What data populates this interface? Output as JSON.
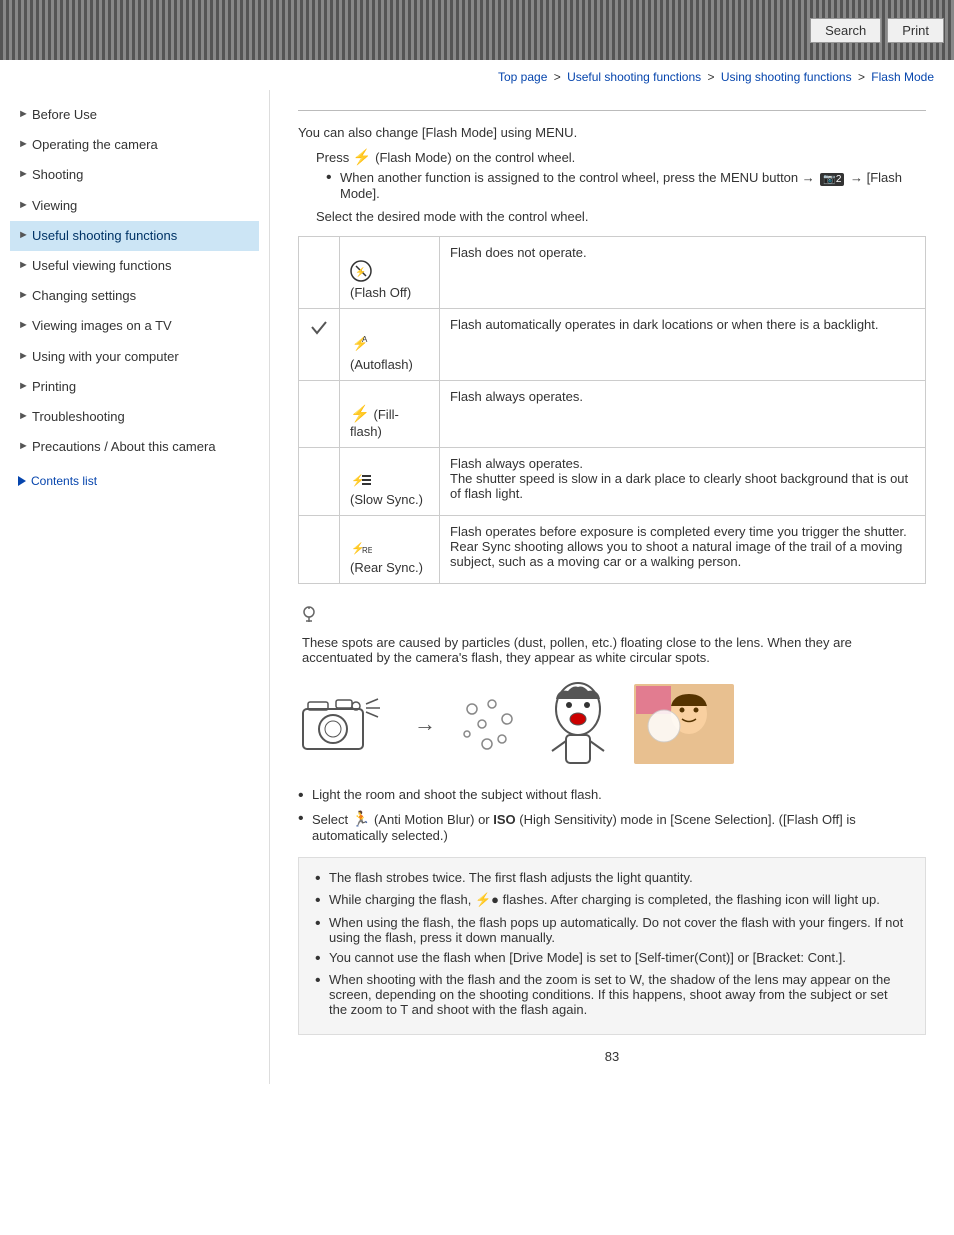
{
  "header": {
    "search_label": "Search",
    "print_label": "Print"
  },
  "breadcrumb": {
    "items": [
      {
        "label": "Top page",
        "href": "#"
      },
      {
        "label": "Useful shooting functions",
        "href": "#"
      },
      {
        "label": "Using shooting functions",
        "href": "#"
      },
      {
        "label": "Flash Mode",
        "href": "#"
      }
    ]
  },
  "sidebar": {
    "items": [
      {
        "label": "Before Use",
        "active": false
      },
      {
        "label": "Operating the camera",
        "active": false
      },
      {
        "label": "Shooting",
        "active": false
      },
      {
        "label": "Viewing",
        "active": false
      },
      {
        "label": "Useful shooting functions",
        "active": true
      },
      {
        "label": "Useful viewing functions",
        "active": false
      },
      {
        "label": "Changing settings",
        "active": false
      },
      {
        "label": "Viewing images on a TV",
        "active": false
      },
      {
        "label": "Using with your computer",
        "active": false
      },
      {
        "label": "Printing",
        "active": false
      },
      {
        "label": "Troubleshooting",
        "active": false
      },
      {
        "label": "Precautions / About this camera",
        "active": false
      }
    ],
    "contents_list_label": "Contents list"
  },
  "main": {
    "intro": "You can also change [Flash Mode] using MENU.",
    "press_line": "Press ⚡ (Flash Mode) on the control wheel.",
    "bullet1": "When another function is assigned to the control wheel, press the MENU button → [camera]2 → [Flash Mode].",
    "select_line": "Select the desired mode with the control wheel.",
    "table": {
      "rows": [
        {
          "icon": "⊕ (Flash\nOff)",
          "checked": false,
          "description": "Flash does not operate."
        },
        {
          "icon": "🔆\n(Autoflash)",
          "checked": true,
          "description": "Flash automatically operates in dark locations or when there is a backlight."
        },
        {
          "icon": "⚡ (Fill-\nflash)",
          "checked": false,
          "description": "Flash always operates."
        },
        {
          "icon": "⚡ (Slow\nSync.)",
          "checked": false,
          "description": "Flash always operates.\nThe shutter speed is slow in a dark place to clearly shoot background that is out of flash light."
        },
        {
          "icon": "⚡ (Rear\nSync.)",
          "checked": false,
          "description": "Flash operates before exposure is completed every time you trigger the shutter. Rear Sync shooting allows you to shoot a natural image of the trail of a moving subject, such as a moving car or a walking person."
        }
      ]
    },
    "tip": {
      "text": "These spots are caused by particles (dust, pollen, etc.) floating close to the lens. When they are accentuated by the camera's flash, they appear as white circular spots."
    },
    "bullets": [
      "Light the room and shoot the subject without flash.",
      "Select 🎭 (Anti Motion Blur) or ISO (High Sensitivity) mode in [Scene Selection]. ([Flash Off] is automatically selected.)"
    ],
    "info_bullets": [
      "The flash strobes twice. The first flash adjusts the light quantity.",
      "While charging the flash, ⚡● flashes. After charging is completed, the flashing icon will light up.",
      "When using the flash, the flash pops up automatically. Do not cover the flash with your fingers. If not using the flash, press it down manually.",
      "You cannot use the flash when [Drive Mode] is set to [Self-timer(Cont)] or [Bracket: Cont.].",
      "When shooting with the flash and the zoom is set to W, the shadow of the lens may appear on the screen, depending on the shooting conditions. If this happens, shoot away from the subject or set the zoom to T and shoot with the flash again."
    ],
    "page_number": "83"
  }
}
